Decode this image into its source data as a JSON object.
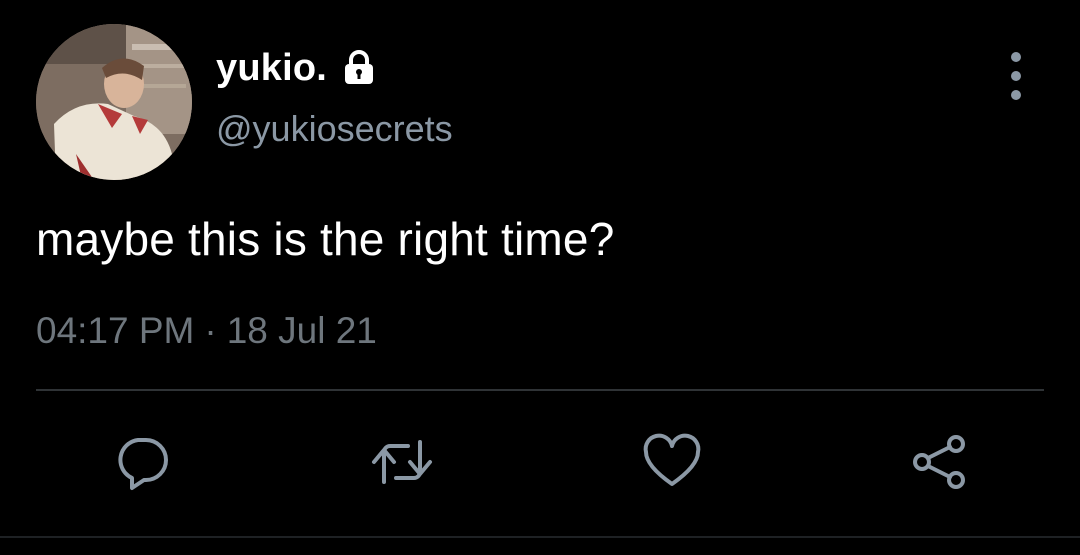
{
  "tweet": {
    "display_name": "yukio.",
    "handle": "@yukiosecrets",
    "text": "maybe this is the right time?",
    "time": "04:17 PM",
    "separator": "·",
    "date": "18 Jul 21",
    "protected": true
  },
  "icons": {
    "lock": "lock-icon",
    "more": "more-vertical-icon",
    "reply": "reply-icon",
    "retweet": "retweet-icon",
    "like": "heart-icon",
    "share": "share-icon"
  },
  "colors": {
    "background": "#000000",
    "primary_text": "#ffffff",
    "secondary_text": "#8b98a5",
    "timestamp_text": "#6e767d",
    "divider": "#2f3336",
    "icon": "#8b98a5"
  }
}
